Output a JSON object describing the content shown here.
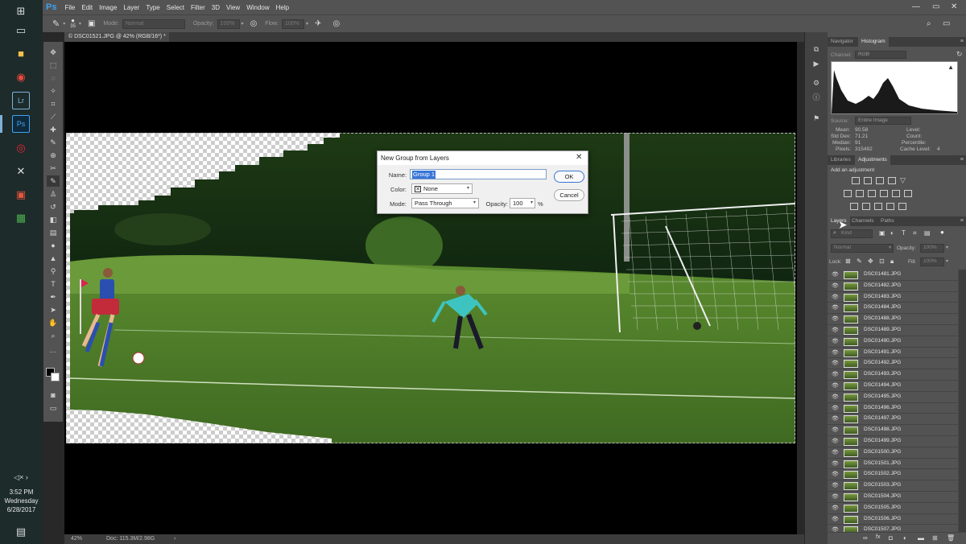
{
  "taskbar": {
    "clock_time": "3:52 PM",
    "clock_day": "Wednesday",
    "clock_date": "6/28/2017"
  },
  "menubar": {
    "logo": "Ps",
    "items": [
      "File",
      "Edit",
      "Image",
      "Layer",
      "Type",
      "Select",
      "Filter",
      "3D",
      "View",
      "Window",
      "Help"
    ]
  },
  "options": {
    "brush_size": "35",
    "mode_label": "Mode:",
    "mode_value": "Normal",
    "opacity_label": "Opacity:",
    "opacity_value": "100%",
    "flow_label": "Flow:",
    "flow_value": "100%"
  },
  "document": {
    "tab_title": "© DSC01521.JPG @ 42% (RGB/16*) *",
    "zoom": "42%",
    "doc_info": "Doc: 115.3M/2.98G"
  },
  "dialog": {
    "title": "New Group from Layers",
    "name_label": "Name:",
    "name_value": "Group 1",
    "color_label": "Color:",
    "color_value": "None",
    "mode_label": "Mode:",
    "mode_value": "Pass Through",
    "opacity_label": "Opacity:",
    "opacity_value": "100",
    "opacity_unit": "%",
    "ok_label": "OK",
    "cancel_label": "Cancel"
  },
  "navigator_panel": {
    "tabs": [
      "Navigator",
      "Histogram"
    ],
    "channel_label": "Channel:",
    "channel_value": "RGB",
    "source_label": "Source:",
    "source_value": "Entire Image",
    "stats_left": [
      {
        "label": "Mean:",
        "value": "90.58"
      },
      {
        "label": "Std Dev:",
        "value": "71.21"
      },
      {
        "label": "Median:",
        "value": "91"
      },
      {
        "label": "Pixels:",
        "value": "315492"
      }
    ],
    "stats_right": [
      {
        "label": "Level:",
        "value": ""
      },
      {
        "label": "Count:",
        "value": ""
      },
      {
        "label": "Percentile:",
        "value": ""
      },
      {
        "label": "Cache Level:",
        "value": "4"
      }
    ]
  },
  "adjustments_panel": {
    "tabs": [
      "Libraries",
      "Adjustments"
    ],
    "add_label": "Add an adjustment"
  },
  "layers_panel": {
    "tabs": [
      "Layers",
      "Channels",
      "Paths"
    ],
    "kind_value": "Kind",
    "blend_value": "Normal",
    "opacity_label": "Opacity:",
    "opacity_value": "100%",
    "lock_label": "Lock:",
    "fill_label": "Fill:",
    "fill_value": "100%",
    "layers": [
      "DSC01481.JPG",
      "DSC01482.JPG",
      "DSC01483.JPG",
      "DSC01484.JPG",
      "DSC01488.JPG",
      "DSC01489.JPG",
      "DSC01490.JPG",
      "DSC01491.JPG",
      "DSC01492.JPG",
      "DSC01493.JPG",
      "DSC01494.JPG",
      "DSC01495.JPG",
      "DSC01496.JPG",
      "DSC01497.JPG",
      "DSC01498.JPG",
      "DSC01499.JPG",
      "DSC01500.JPG",
      "DSC01501.JPG",
      "DSC01502.JPG",
      "DSC01503.JPG",
      "DSC01504.JPG",
      "DSC01505.JPG",
      "DSC01506.JPG",
      "DSC01507.JPG"
    ]
  }
}
